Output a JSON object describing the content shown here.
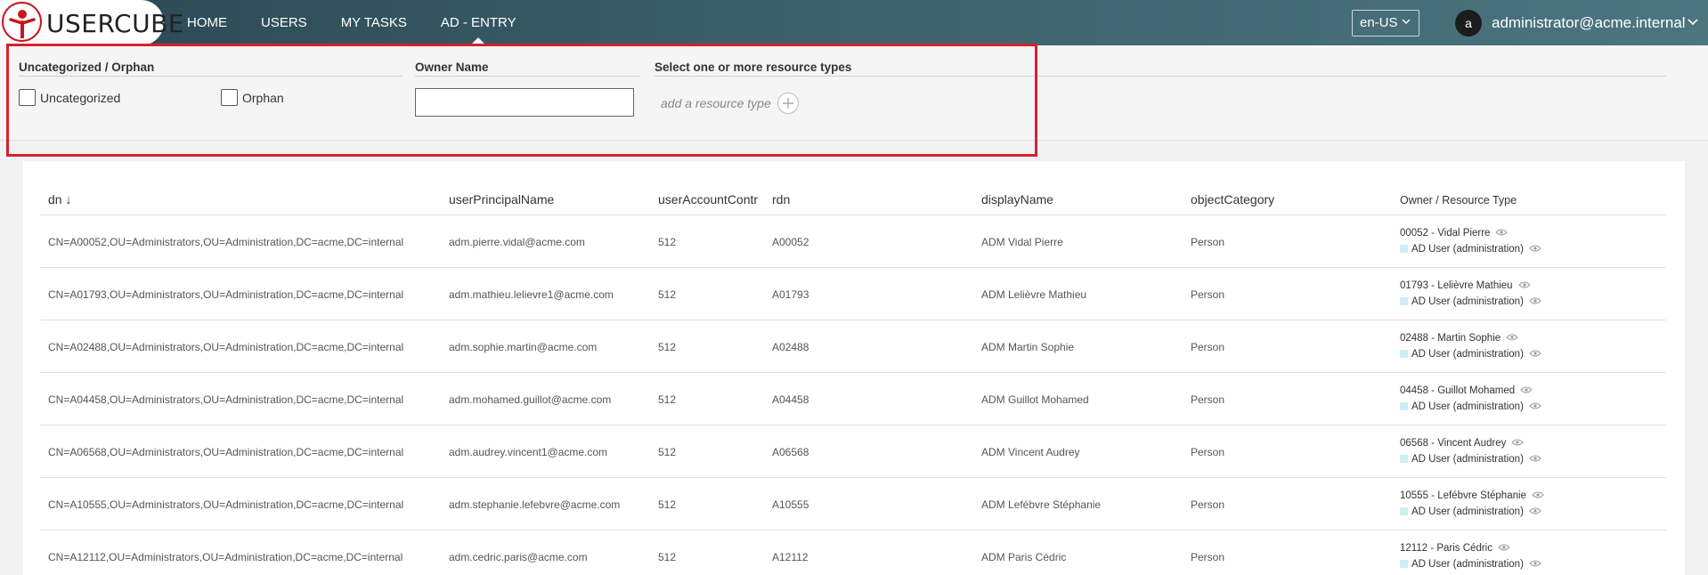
{
  "app": {
    "logo_text": "USERCUBE"
  },
  "nav": {
    "items": [
      "HOME",
      "USERS",
      "MY TASKS",
      "AD - ENTRY"
    ],
    "active_index": 3
  },
  "header": {
    "language": "en-US",
    "avatar_initial": "a",
    "user": "administrator@acme.internal"
  },
  "filters": {
    "uncategorized_orphan_title": "Uncategorized / Orphan",
    "uncategorized_label": "Uncategorized",
    "orphan_label": "Orphan",
    "owner_name_title": "Owner Name",
    "owner_name_value": "",
    "resource_types_title": "Select one or more resource types",
    "add_resource_type_placeholder": "add a resource type"
  },
  "table": {
    "columns": [
      "dn ↓",
      "userPrincipalName",
      "userAccountControl",
      "rdn",
      "displayName",
      "objectCategory",
      "Owner / Resource Type"
    ],
    "rows": [
      {
        "dn": "CN=A00052,OU=Administrators,OU=Administration,DC=acme,DC=internal",
        "upn": "adm.pierre.vidal@acme.com",
        "uac": "512",
        "rdn": "A00052",
        "display_name": "ADM Vidal Pierre",
        "object_category": "Person",
        "owner": "00052 - Vidal Pierre",
        "resource_type": "AD User (administration)"
      },
      {
        "dn": "CN=A01793,OU=Administrators,OU=Administration,DC=acme,DC=internal",
        "upn": "adm.mathieu.lelievre1@acme.com",
        "uac": "512",
        "rdn": "A01793",
        "display_name": "ADM Lelièvre Mathieu",
        "object_category": "Person",
        "owner": "01793 - Lelièvre Mathieu",
        "resource_type": "AD User (administration)"
      },
      {
        "dn": "CN=A02488,OU=Administrators,OU=Administration,DC=acme,DC=internal",
        "upn": "adm.sophie.martin@acme.com",
        "uac": "512",
        "rdn": "A02488",
        "display_name": "ADM Martin Sophie",
        "object_category": "Person",
        "owner": "02488 - Martin Sophie",
        "resource_type": "AD User (administration)"
      },
      {
        "dn": "CN=A04458,OU=Administrators,OU=Administration,DC=acme,DC=internal",
        "upn": "adm.mohamed.guillot@acme.com",
        "uac": "512",
        "rdn": "A04458",
        "display_name": "ADM Guillot Mohamed",
        "object_category": "Person",
        "owner": "04458 - Guillot Mohamed",
        "resource_type": "AD User (administration)"
      },
      {
        "dn": "CN=A06568,OU=Administrators,OU=Administration,DC=acme,DC=internal",
        "upn": "adm.audrey.vincent1@acme.com",
        "uac": "512",
        "rdn": "A06568",
        "display_name": "ADM Vincent Audrey",
        "object_category": "Person",
        "owner": "06568 - Vincent Audrey",
        "resource_type": "AD User (administration)"
      },
      {
        "dn": "CN=A10555,OU=Administrators,OU=Administration,DC=acme,DC=internal",
        "upn": "adm.stephanie.lefebvre@acme.com",
        "uac": "512",
        "rdn": "A10555",
        "display_name": "ADM Lefébvre Stéphanie",
        "object_category": "Person",
        "owner": "10555 - Lefébvre Stéphanie",
        "resource_type": "AD User (administration)"
      },
      {
        "dn": "CN=A12112,OU=Administrators,OU=Administration,DC=acme,DC=internal",
        "upn": "adm.cedric.paris@acme.com",
        "uac": "512",
        "rdn": "A12112",
        "display_name": "ADM Paris Cédric",
        "object_category": "Person",
        "owner": "12112 - Paris Cédric",
        "resource_type": "AD User (administration)"
      }
    ]
  },
  "colors": {
    "highlight": "#d6222c",
    "topbar": "#2b4752",
    "logo_red": "#c8161d",
    "resource_type_chip": "#cfeef2"
  },
  "icons": [
    "usercube-logo-icon",
    "chevron-down-icon",
    "plus-icon",
    "eye-icon"
  ]
}
